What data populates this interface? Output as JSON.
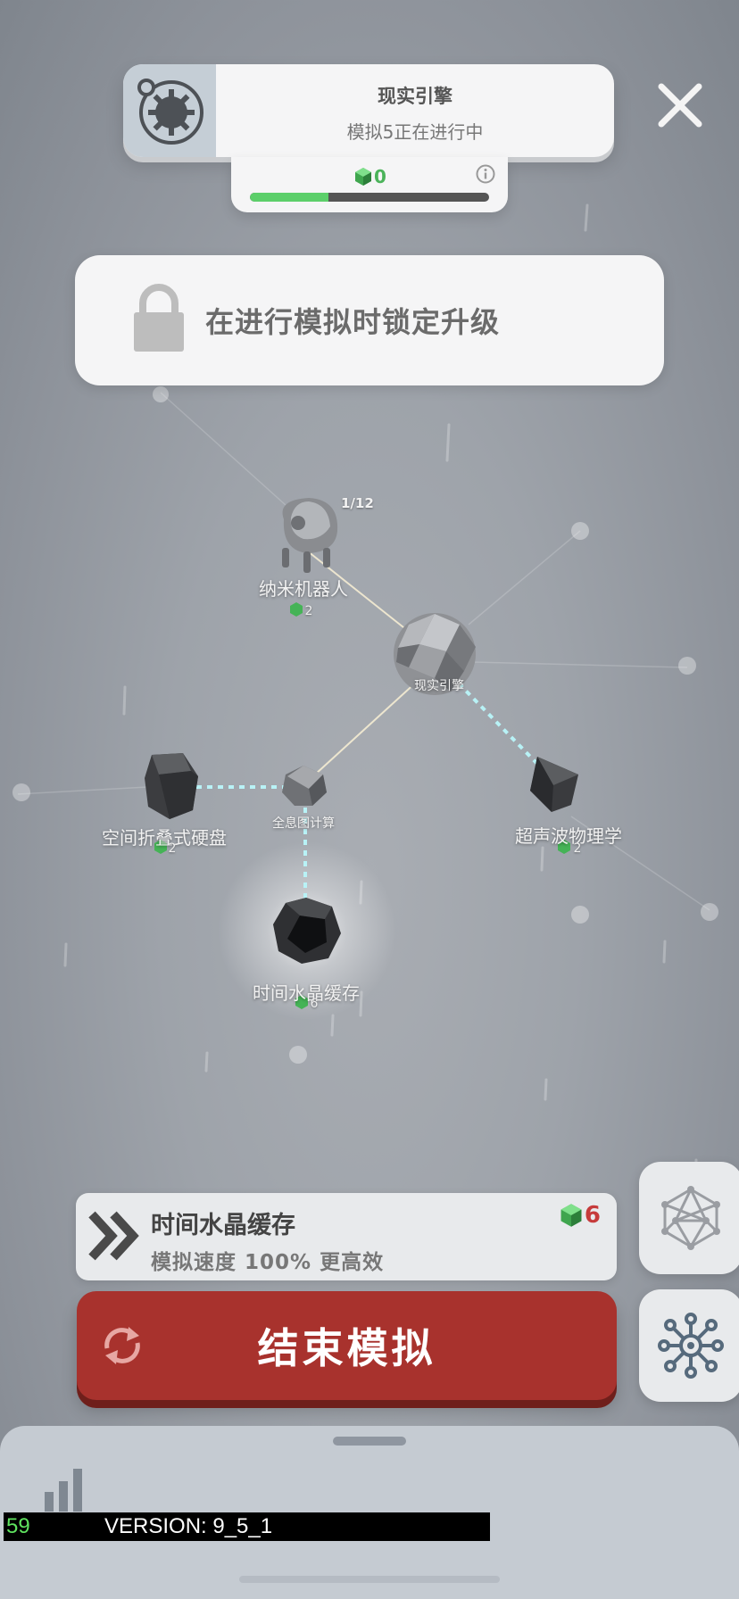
{
  "header": {
    "title": "现实引擎",
    "subtitle": "模拟5正在进行中",
    "close_icon": "close-icon",
    "engine_icon": "gear-engine-icon"
  },
  "progress": {
    "gem_count": "0",
    "fraction": 0.33,
    "info_icon": "info-icon"
  },
  "lock_notice": {
    "text": "在进行模拟时锁定升级",
    "icon": "lock-icon"
  },
  "nodes": [
    {
      "id": "nanobot",
      "name": "纳米机器人",
      "cost": "2",
      "level": "1/12"
    },
    {
      "id": "reality-engine",
      "name": "现实引擎"
    },
    {
      "id": "hologram",
      "name": "全息图计算"
    },
    {
      "id": "space-fold-drive",
      "name": "空间折叠式硬盘",
      "cost": "2"
    },
    {
      "id": "ultrasonic-physics",
      "name": "超声波物理学",
      "cost": "2"
    },
    {
      "id": "time-crystal-cache",
      "name": "时间水晶缓存",
      "cost": "6"
    }
  ],
  "selected_upgrade": {
    "title": "时间水晶缓存",
    "description": "模拟速度 100% 更高效",
    "cost": "6",
    "icon": "double-chevron-icon"
  },
  "end_button": {
    "label": "结束模拟",
    "icon": "refresh-icon"
  },
  "side_buttons": [
    {
      "name": "network-view-button",
      "icon": "crystal-lattice-icon"
    },
    {
      "name": "skill-tree-button",
      "icon": "molecule-node-icon"
    }
  ],
  "debug": {
    "fps": "59",
    "version": "VERSION: 9_5_1",
    "signal_icon": "signal-bars-icon"
  },
  "colors": {
    "end_button": "#a8322d",
    "progress_fill": "#5ccf6a",
    "cost_red": "#c63b3b",
    "gem_green": "#4bb35a"
  }
}
